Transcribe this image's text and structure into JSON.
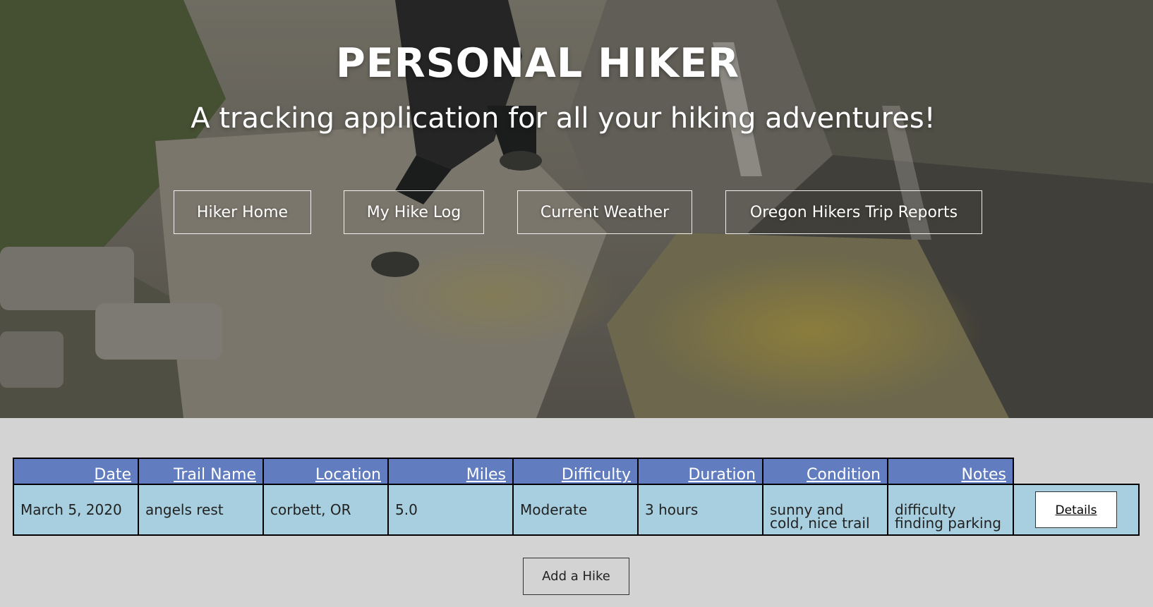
{
  "header": {
    "title": "PERSONAL HIKER",
    "subtitle": "A tracking application for all your hiking adventures!"
  },
  "nav": {
    "items": [
      {
        "label": "Hiker Home"
      },
      {
        "label": "My Hike Log"
      },
      {
        "label": "Current Weather"
      },
      {
        "label": "Oregon Hikers Trip Reports"
      }
    ]
  },
  "table": {
    "columns": [
      "Date",
      "Trail Name",
      "Location",
      "Miles",
      "Difficulty",
      "Duration",
      "Condition",
      "Notes"
    ],
    "rows": [
      {
        "date": "March 5, 2020",
        "trail_name": "angels rest",
        "location": "corbett, OR",
        "miles": "5.0",
        "difficulty": "Moderate",
        "duration": "3 hours",
        "condition": "sunny and cold, nice trail",
        "notes": "difficulty finding parking",
        "details_label": "Details"
      }
    ]
  },
  "actions": {
    "add_label": "Add a Hike"
  },
  "colors": {
    "page_background": "#d3d3d3",
    "header_row": "#627dbf",
    "data_row": "#a8cfdf"
  }
}
